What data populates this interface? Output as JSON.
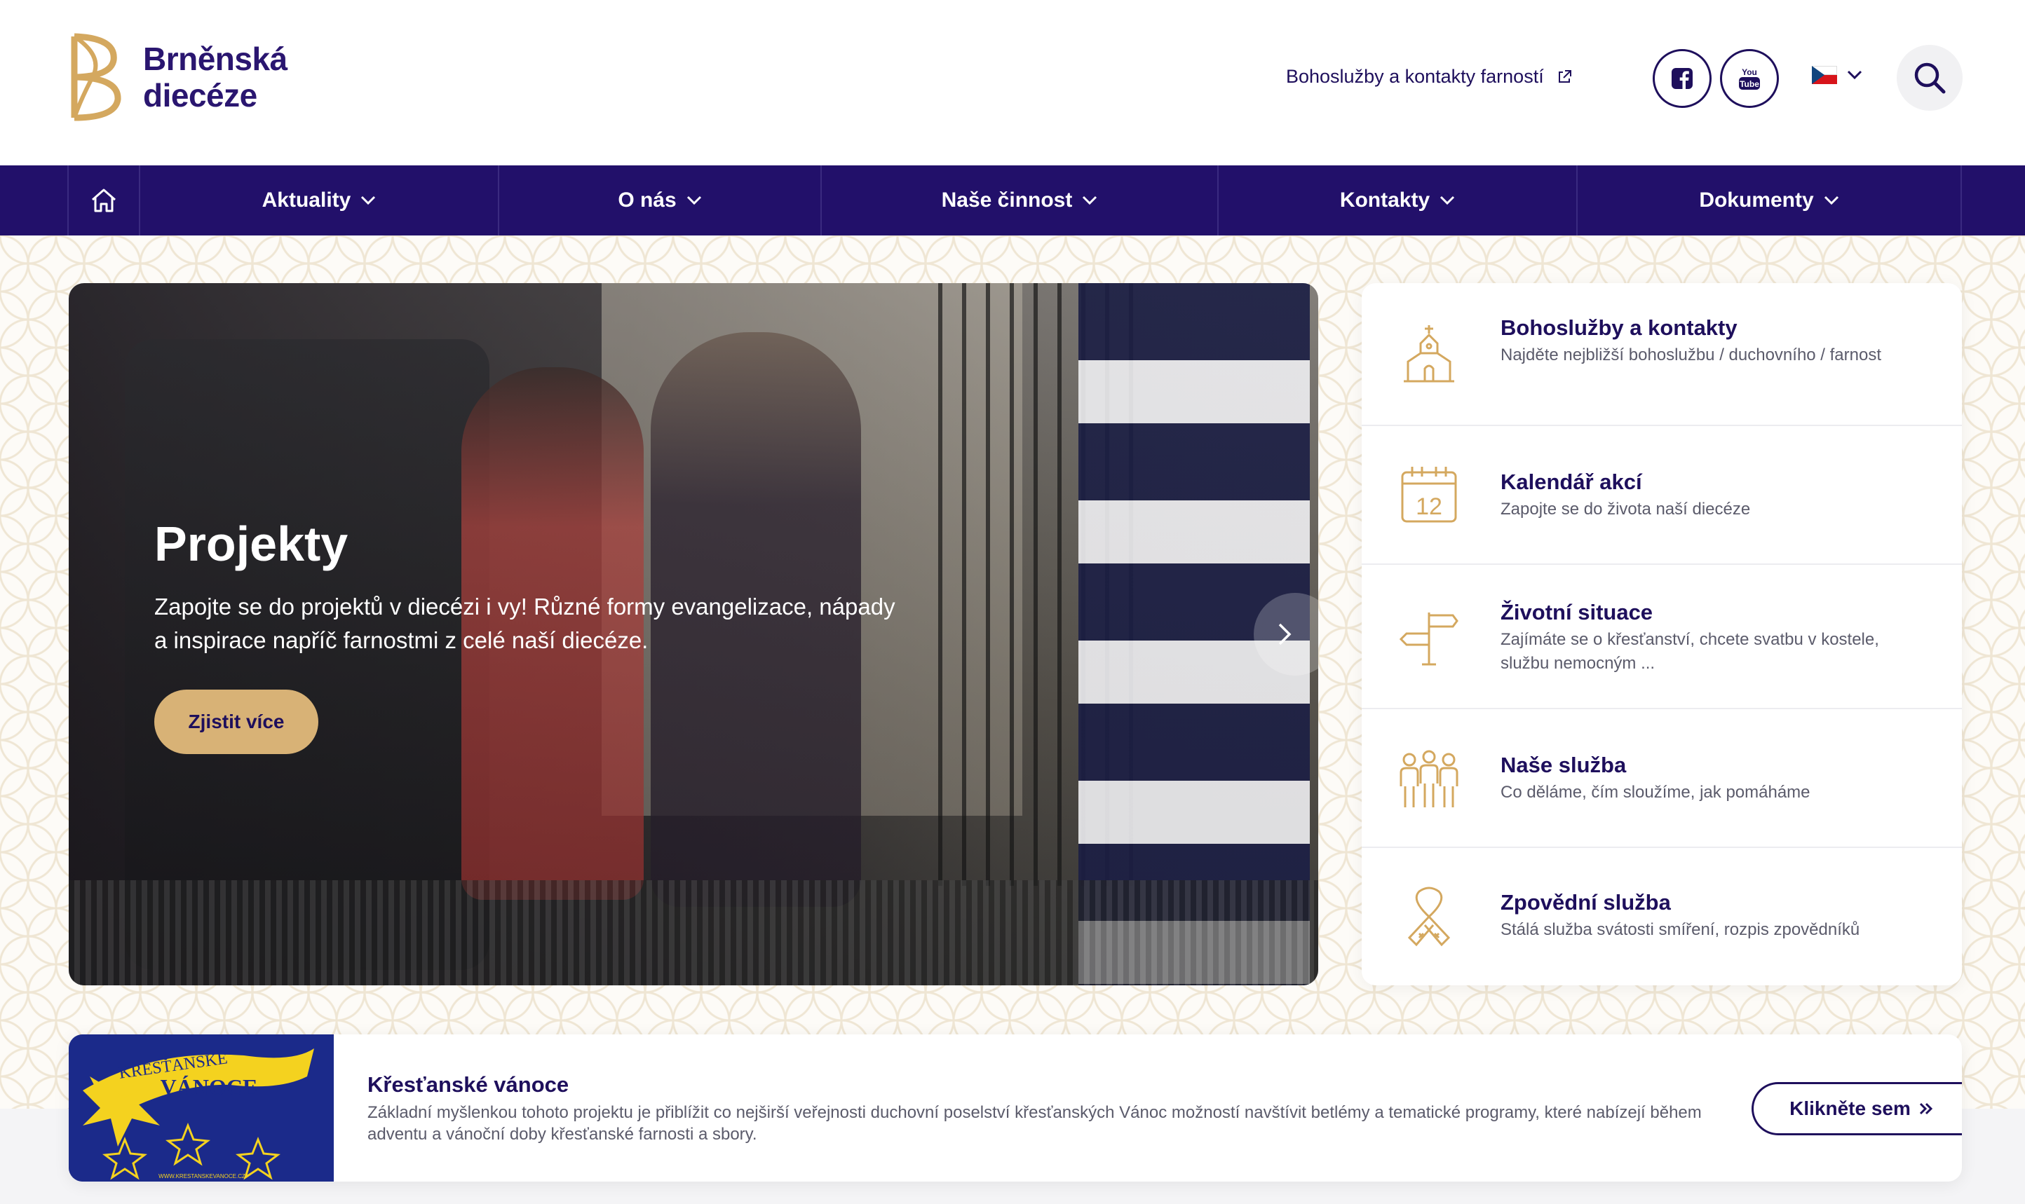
{
  "brand": {
    "line1": "Brněnská",
    "line2": "diecéze",
    "gold": "#d4a85f",
    "navy": "#22106a"
  },
  "header": {
    "ext_link": "Bohoslužby a kontakty farností",
    "social": [
      "facebook-icon",
      "youtube-icon"
    ],
    "lang": "cs",
    "search_icon": "search-icon"
  },
  "nav": {
    "home_icon": "home-icon",
    "items": [
      {
        "label": "Aktuality"
      },
      {
        "label": "O nás"
      },
      {
        "label": "Naše činnost"
      },
      {
        "label": "Kontakty"
      },
      {
        "label": "Dokumenty"
      }
    ]
  },
  "hero": {
    "title": "Projekty",
    "text": "Zapojte se do projektů v diecézi i vy! Různé formy evangelizace, nápady a inspirace napříč farnostmi z celé naší diecéze.",
    "button": "Zjistit více"
  },
  "quick_links": [
    {
      "title": "Bohoslužby a kontakty",
      "desc": "Najděte nejbližší bohoslužbu / duchovního / farnost",
      "icon": "church-icon"
    },
    {
      "title": "Kalendář akcí",
      "desc": "Zapojte se do života naší diecéze",
      "icon": "calendar-icon",
      "icon_text": "12"
    },
    {
      "title": "Životní situace",
      "desc": "Zajímáte se o křesťanství, chcete svatbu v kostele, službu nemocným ...",
      "icon": "signpost-icon"
    },
    {
      "title": "Naše služba",
      "desc": "Co děláme, čím sloužíme, jak pomáháme",
      "icon": "people-icon"
    },
    {
      "title": "Zpovědní služba",
      "desc": "Stálá služba svátosti smíření, rozpis zpovědníků",
      "icon": "ribbon-icon"
    }
  ],
  "banner": {
    "img_line1": "KŘESŤANSKÉ",
    "img_line2": "VÁNOCE",
    "img_url": "WWW.KRESTANSKEVANOCE.CZ",
    "title": "Křesťanské vánoce",
    "desc": "Základní myšlenkou tohoto projektu je přiblížit co nejširší veřejnosti duchovní poselství křesťanských Vánoc možností navštívit betlémy a tematické programy, které nabízejí během adventu a vánoční doby křesťanské farnosti a sbory.",
    "button": "Klikněte sem"
  }
}
